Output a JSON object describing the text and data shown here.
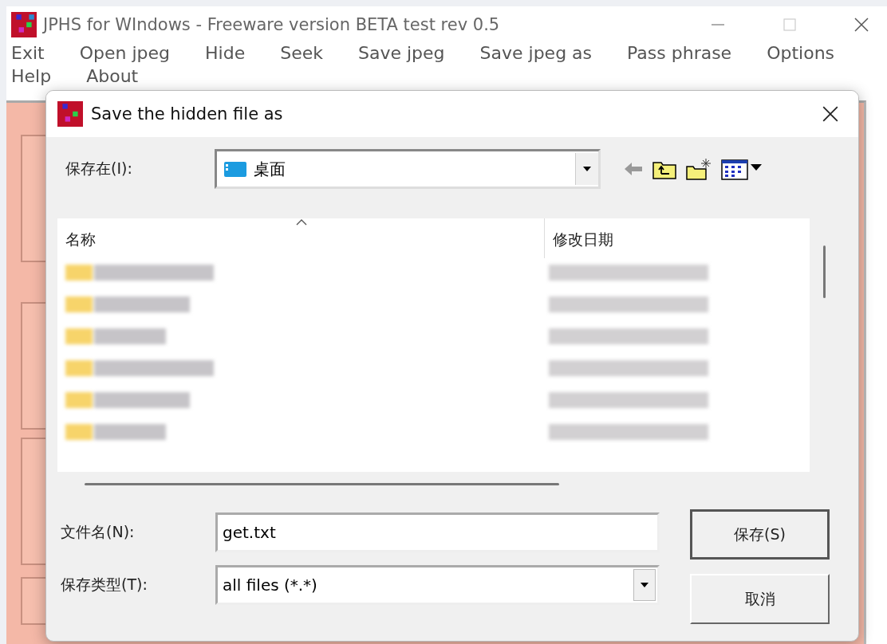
{
  "window": {
    "title": "JPHS for WIndows - Freeware version BETA test rev 0.5"
  },
  "menu": [
    {
      "label": "Exit"
    },
    {
      "label": "Open jpeg"
    },
    {
      "label": "Hide"
    },
    {
      "label": "Seek"
    },
    {
      "label": "Save jpeg"
    },
    {
      "label": "Save jpeg as"
    },
    {
      "label": "Pass phrase"
    },
    {
      "label": "Options"
    },
    {
      "label": "Help"
    },
    {
      "label": "About"
    }
  ],
  "dialog": {
    "title": "Save the hidden file as",
    "save_in": {
      "label": "保存在(I):",
      "value": "桌面"
    },
    "columns": [
      {
        "label": "名称",
        "sorted": true
      },
      {
        "label": "修改日期",
        "sorted": false
      }
    ],
    "file_name": {
      "label": "文件名(N):",
      "value": "get.txt"
    },
    "file_type": {
      "label": "保存类型(T):",
      "value": "all files (*.*)"
    },
    "buttons": [
      {
        "label": "保存(S)",
        "default": true
      },
      {
        "label": "取消",
        "default": false
      }
    ]
  }
}
